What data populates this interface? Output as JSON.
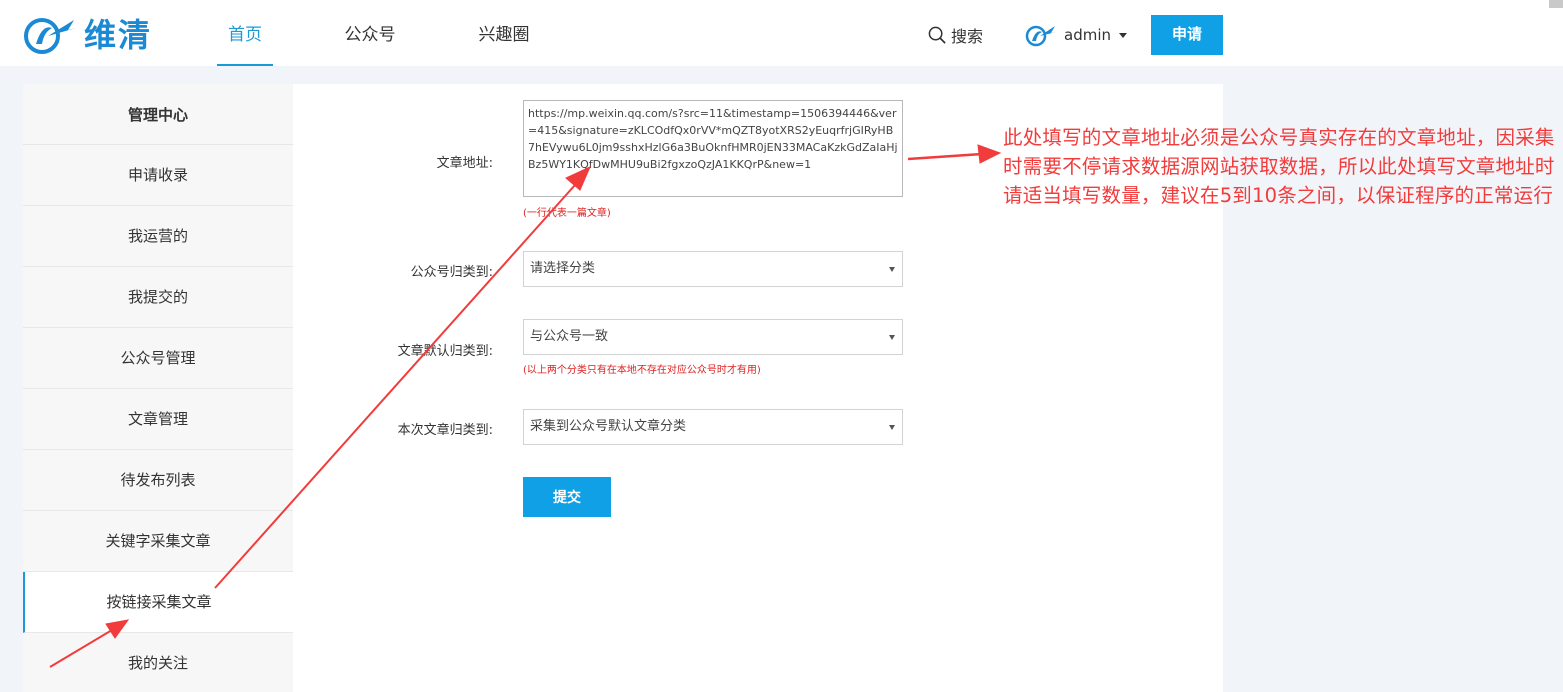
{
  "header": {
    "logo_text": "维清",
    "nav": [
      {
        "label": "首页",
        "active": true
      },
      {
        "label": "公众号",
        "active": false
      },
      {
        "label": "兴趣圈",
        "active": false
      }
    ],
    "search_label": "搜索",
    "username": "admin",
    "apply_label": "申请",
    "brand_color": "#1a8ad4",
    "accent_color": "#10a0e5"
  },
  "sidebar": {
    "title": "管理中心",
    "items": [
      {
        "label": "申请收录",
        "active": false
      },
      {
        "label": "我运营的",
        "active": false
      },
      {
        "label": "我提交的",
        "active": false
      },
      {
        "label": "公众号管理",
        "active": false
      },
      {
        "label": "文章管理",
        "active": false
      },
      {
        "label": "待发布列表",
        "active": false
      },
      {
        "label": "关键字采集文章",
        "active": false
      },
      {
        "label": "按链接采集文章",
        "active": true
      },
      {
        "label": "我的关注",
        "active": false
      }
    ]
  },
  "form": {
    "url_label": "文章地址:",
    "url_value": "https://mp.weixin.qq.com/s?src=11&timestamp=1506394446&ver=415&signature=zKLCOdfQx0rVV*mQZT8yotXRS2yEuqrfrjGIRyHB7hEVywu6L0jm9sshxHzlG6a3BuOknfHMR0jEN33MACaKzkGdZaIaHjBz5WY1KQfDwMHU9uBi2fgxzoQzJA1KKQrP&new=1",
    "url_hint": "(一行代表一篇文章)",
    "account_category_label": "公众号归类到:",
    "account_category_value": "请选择分类",
    "article_default_label": "文章默认归类到:",
    "article_default_value": "与公众号一致",
    "category_hint": "(以上两个分类只有在本地不存在对应公众号时才有用)",
    "this_time_label": "本次文章归类到:",
    "this_time_value": "采集到公众号默认文章分类",
    "submit_label": "提交",
    "hint_color": "#e02020"
  },
  "annotation": {
    "text": "此处填写的文章地址必须是公众号真实存在的文章地址，因采集时需要不停请求数据源网站获取数据，所以此处填写文章地址时请适当填写数量，建议在5到10条之间，以保证程序的正常运行",
    "color": "#f23b3b"
  }
}
